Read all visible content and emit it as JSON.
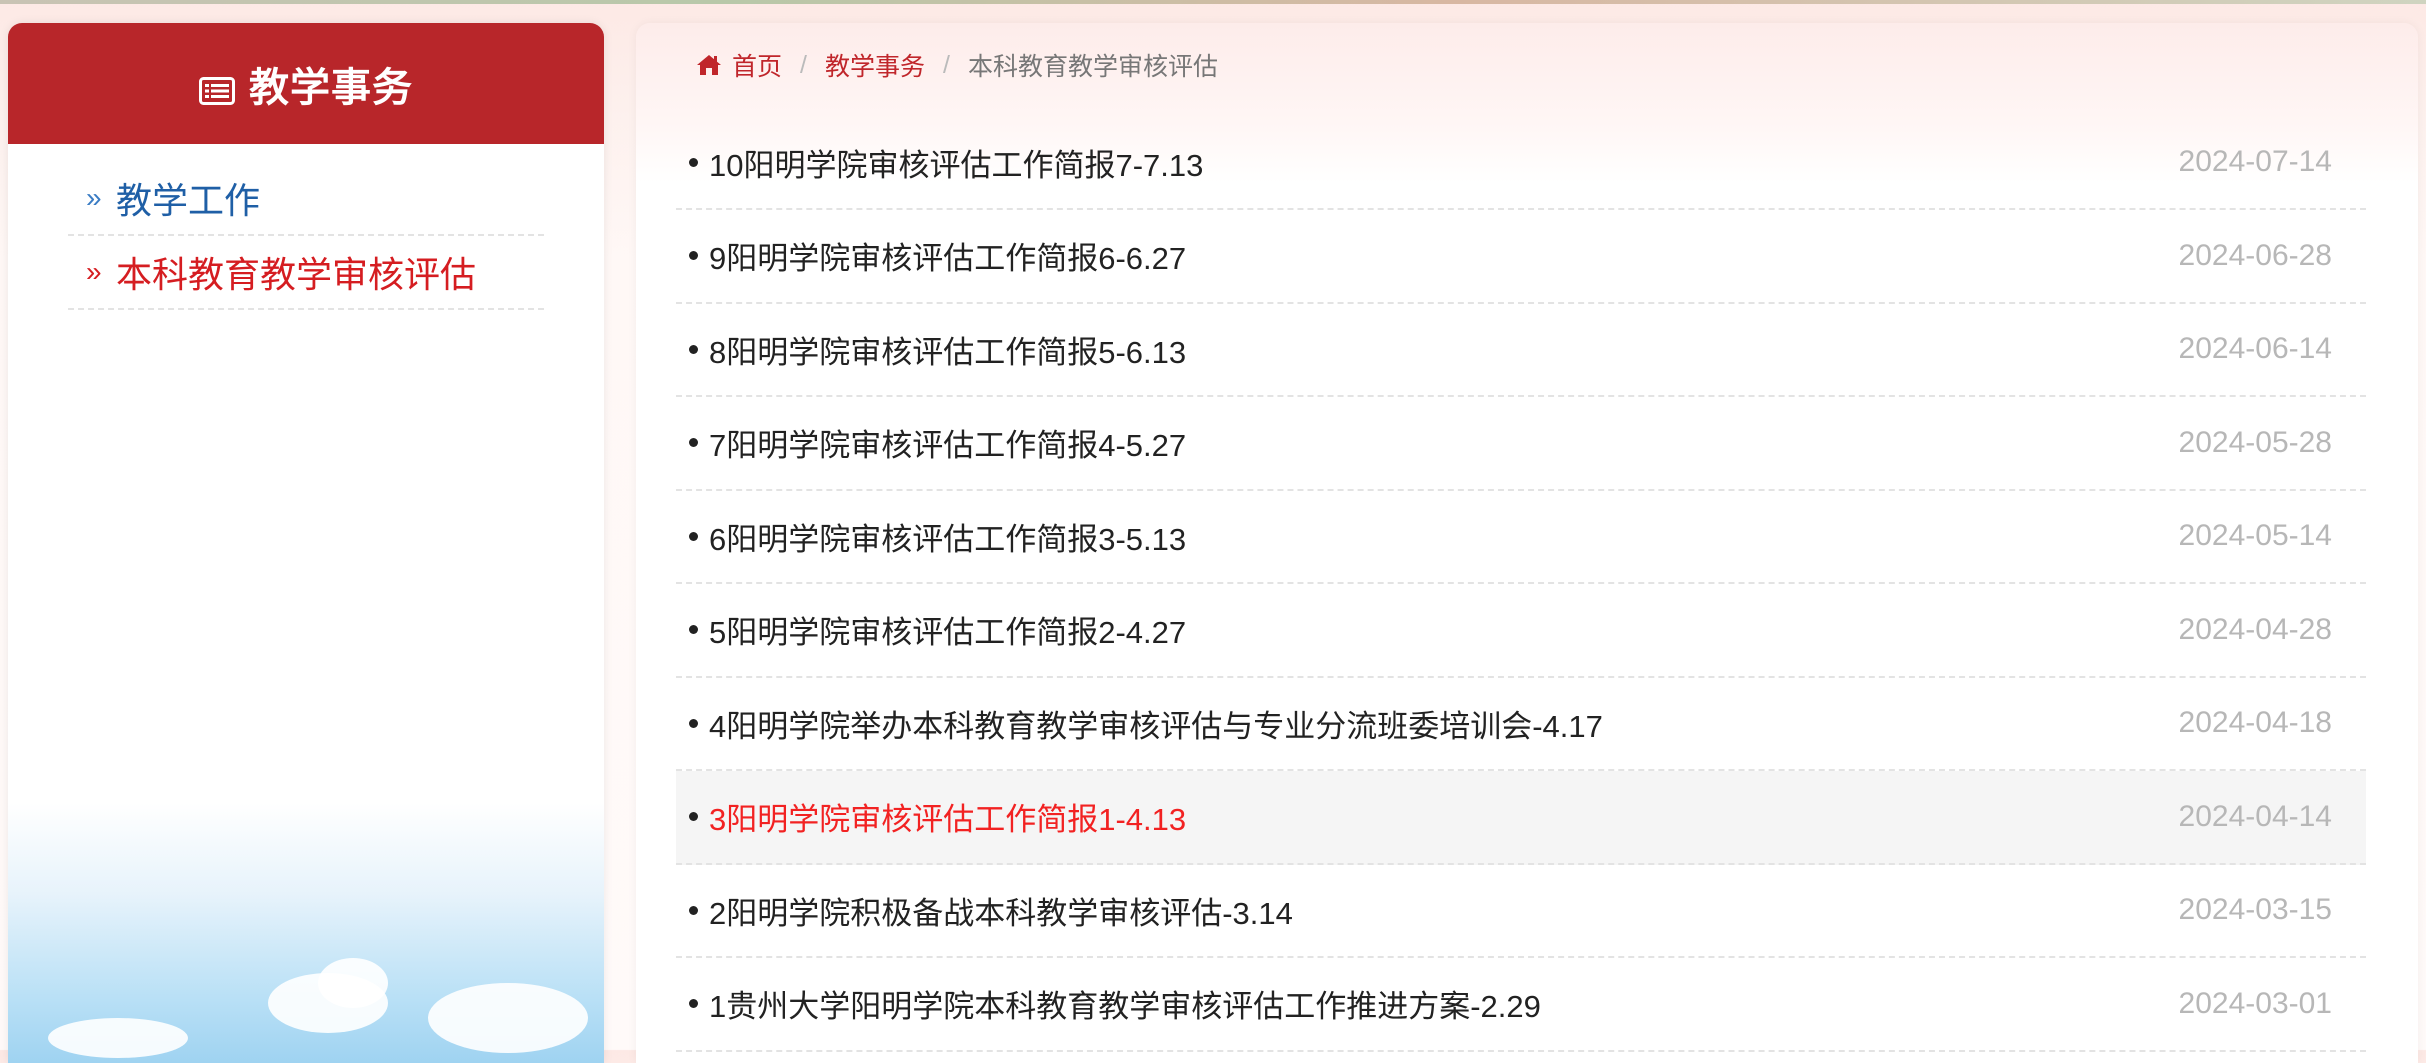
{
  "colors": {
    "accent_red": "#b8262a",
    "link_red": "#d51d21",
    "link_blue": "#1f5fa6",
    "date_gray": "#b7b7b7",
    "hover_title": "#f22222"
  },
  "sidebar": {
    "title": "教学事务",
    "title_icon": "list-alt-icon",
    "items": [
      {
        "label": "教学工作",
        "active": false
      },
      {
        "label": "本科教育教学审核评估",
        "active": true
      }
    ]
  },
  "breadcrumb": {
    "home_icon": "home-icon",
    "home": "首页",
    "section": "教学事务",
    "current": "本科教育教学审核评估",
    "separator": "/"
  },
  "news": [
    {
      "title": "10阳明学院审核评估工作简报7-7.13",
      "date": "2024-07-14"
    },
    {
      "title": "9阳明学院审核评估工作简报6-6.27",
      "date": "2024-06-28"
    },
    {
      "title": "8阳明学院审核评估工作简报5-6.13",
      "date": "2024-06-14"
    },
    {
      "title": "7阳明学院审核评估工作简报4-5.27",
      "date": "2024-05-28"
    },
    {
      "title": "6阳明学院审核评估工作简报3-5.13",
      "date": "2024-05-14"
    },
    {
      "title": "5阳明学院审核评估工作简报2-4.27",
      "date": "2024-04-28"
    },
    {
      "title": "4阳明学院举办本科教育教学审核评估与专业分流班委培训会-4.17",
      "date": "2024-04-18"
    },
    {
      "title": "3阳明学院审核评估工作简报1-4.13",
      "date": "2024-04-14",
      "hovered": true
    },
    {
      "title": "2阳明学院积极备战本科教学审核评估-3.14",
      "date": "2024-03-15"
    },
    {
      "title": "1贵州大学阳明学院本科教育教学审核评估工作推进方案-2.29",
      "date": "2024-03-01"
    }
  ]
}
